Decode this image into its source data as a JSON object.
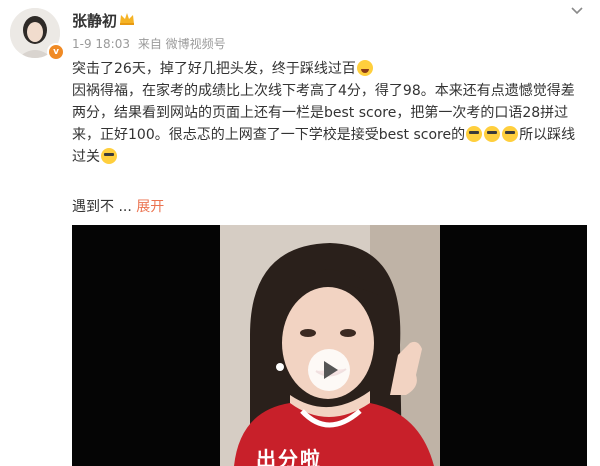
{
  "post": {
    "author": {
      "name": "张静初",
      "avatar_icon": "avatar-icon",
      "badge_icon": "crown-icon",
      "verified_icon": "verified-v-icon"
    },
    "meta": {
      "time": "1-9 18:03",
      "source": "来自 微博视频号"
    },
    "menu_icon": "chevron-down-icon",
    "content": {
      "line1": "突击了26天，掉了好几把头发，终于踩线过百",
      "line2": "因祸得福，在家考的成绩比上次线下考高了4分，得了98。本来还有点遗憾觉得差",
      "line3": "两分，结果看到网站的页面上还有一栏是best score，把第一次考的口语28拼过",
      "line4a": "来，正好100。很忐忑的上网查了一下学校是接受best score的",
      "line4b": "所以踩线",
      "line5": "过关",
      "truncated_text": "遇到不",
      "ellipsis": "...",
      "expand_label": "展开"
    },
    "video": {
      "play_icon": "play-icon",
      "overlay_text": "出分啦"
    }
  },
  "colors": {
    "link": "#eb7350",
    "meta": "#9a9a9a",
    "text": "#333333",
    "video_bg": "#050505",
    "shirt": "#c8202a"
  }
}
